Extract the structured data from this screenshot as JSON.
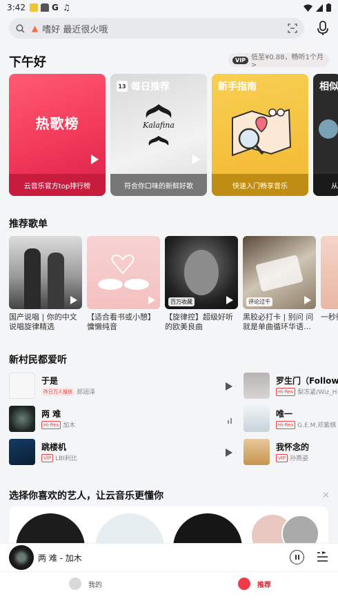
{
  "status": {
    "time": "3:42"
  },
  "search": {
    "hint": "嗜好 最近很火哦"
  },
  "greeting": "下午好",
  "vip": {
    "tag": "VIP",
    "text": "低至¥0.88，畅听1个月>"
  },
  "cards": [
    {
      "title": "",
      "center": "热歌榜",
      "subtitle": "云音乐官方top排行榜"
    },
    {
      "title": "每日推荐",
      "calendar_day": "13",
      "cover_text": "Kalafina",
      "subtitle": "符合你口味的新鲜好歌"
    },
    {
      "title": "新手指南",
      "subtitle": "快速入门畅享音乐"
    },
    {
      "title": "相似",
      "subtitle": "从"
    }
  ],
  "playlists": {
    "heading": "推荐歌单",
    "items": [
      {
        "name": "国产说唱 | 你的中文说唱旋律精选",
        "badge": ""
      },
      {
        "name": "【适合看书或小憩】慵懒纯音",
        "badge": ""
      },
      {
        "name": "【旋律控】超级好听的欧美良曲",
        "badge": "百万收藏"
      },
      {
        "name": "黑胶必打卡 | 别问 问就是单曲循环华语…",
        "badge": "评论过千"
      },
      {
        "name": "一秒彻底",
        "badge": ""
      }
    ]
  },
  "songs": {
    "heading": "新村民都爱听",
    "items": [
      {
        "title": "于是",
        "tag": "昨日万人搜放",
        "artist": "郑润泽"
      },
      {
        "title": "两 难",
        "tag": "Hi-Res",
        "artist": "加木"
      },
      {
        "title": "跳楼机",
        "tag": "VIP",
        "artist": "LBI利比"
      },
      {
        "title": "罗生门（Follow）",
        "tag": "Hi-Res",
        "artist": "梨冻紧/Wiz_H"
      },
      {
        "title": "唯一",
        "tag": "Hi-Res",
        "artist": "G.E.M.邓紫棋"
      },
      {
        "title": "我怀念的",
        "tag": "VIP",
        "artist": "孙燕姿"
      }
    ]
  },
  "artists_heading": "选择你喜欢的艺人，让云音乐更懂你",
  "player": {
    "now_playing": "两 难 - 加木"
  },
  "tabs": {
    "me": "我的",
    "recommend": "推荐"
  }
}
